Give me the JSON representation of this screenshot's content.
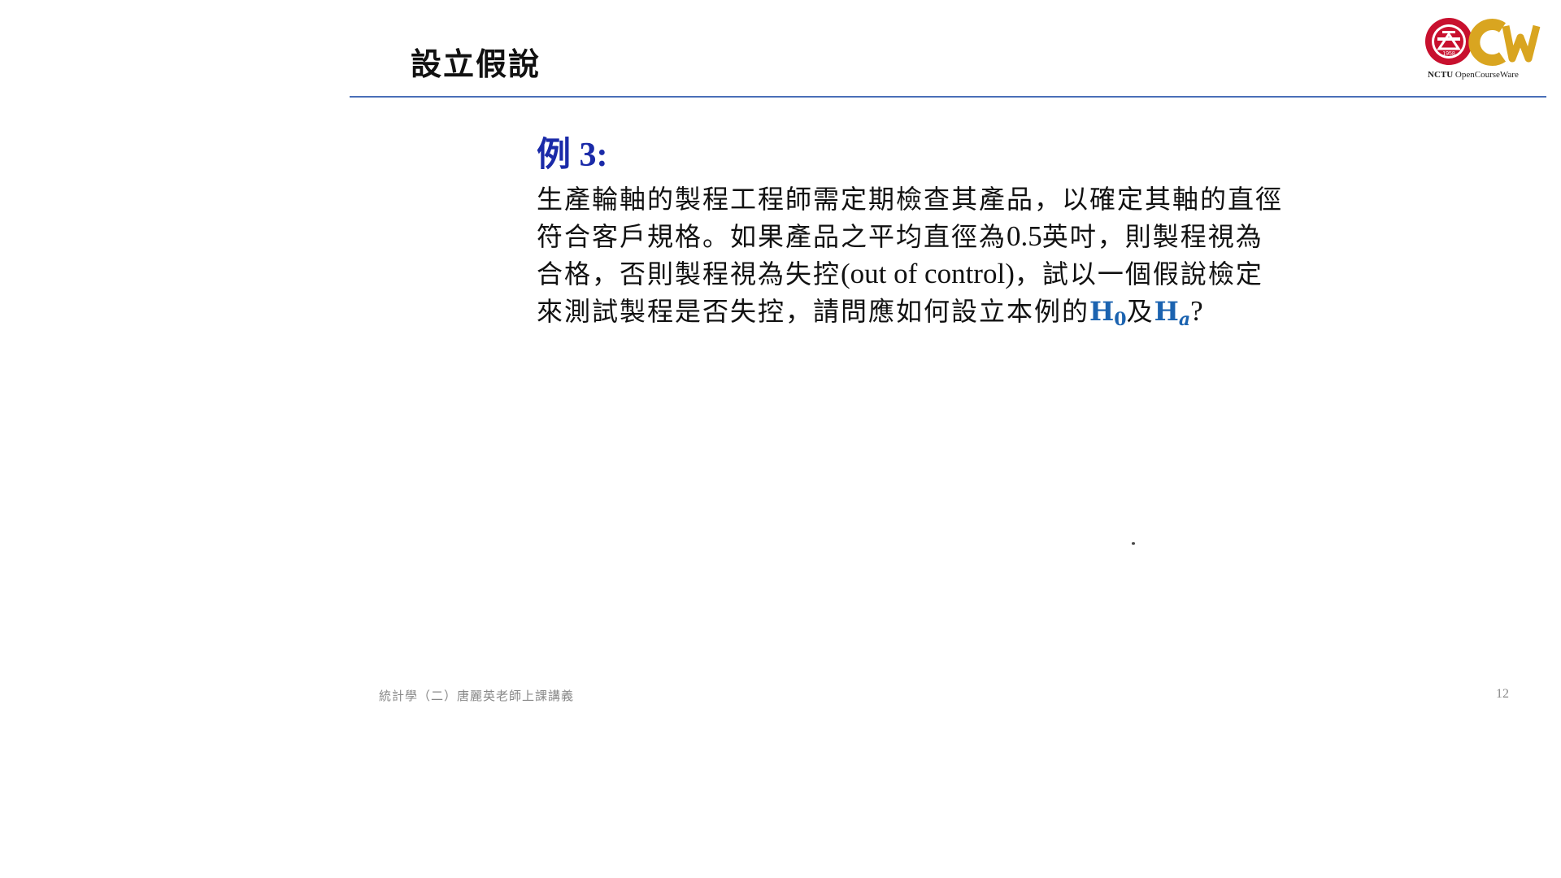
{
  "slide": {
    "title": "設立假說",
    "example_heading": "例 3:",
    "body": {
      "line1": "生產輪軸的製程工程師需定期檢查其產品，以確定其軸的直徑",
      "line2_part1": "符合客戶規格。如果產品之平均直徑為",
      "line2_value": "0.5",
      "line2_part2": "英吋，則製程視為",
      "line3_part1": "合格，否則製程視為失控",
      "line3_latin": "(out of control)",
      "line3_part2": "，試以一個假說檢定",
      "line4_part1": "來測試製程是否失控，請問應如何設立本例的",
      "h0_base": "H",
      "h0_sub": "0",
      "connector": "及",
      "ha_base": "H",
      "ha_sub": "a",
      "question_mark": "?"
    }
  },
  "footer": {
    "course_text": "統計學（二）唐麗英老師上課講義",
    "page_number": "12"
  },
  "logo": {
    "name": "NCTU OpenCourseWare logo",
    "text_bold": "NCTU",
    "text_rest": "OpenCourseWare",
    "badge_text": "1958",
    "colors": {
      "red": "#c8102e",
      "gold": "#d9a520"
    }
  },
  "colors": {
    "heading_blue": "#1a2aa8",
    "math_blue": "#1b63b0",
    "divider": "#4a6fb8",
    "footer_gray": "#888888"
  }
}
